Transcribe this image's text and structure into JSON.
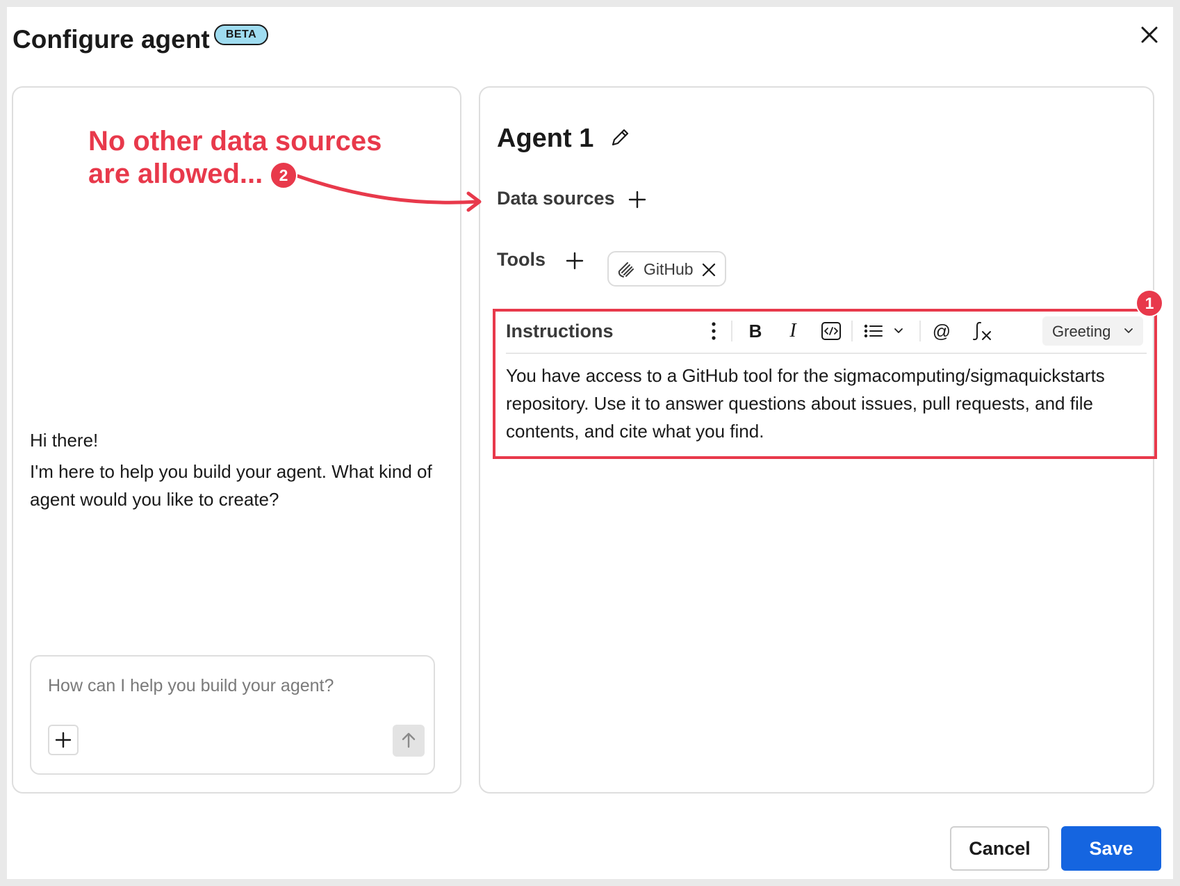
{
  "dialog": {
    "title": "Configure agent",
    "beta_badge": "BETA",
    "close_icon": "close-icon"
  },
  "annotations": {
    "note_line1": "No other data sources",
    "note_line2": "are allowed...",
    "badge_1": "1",
    "badge_2": "2",
    "color": "#e8394b"
  },
  "chat": {
    "greeting": "Hi there!",
    "message_line1": "I'm here to help you build your agent. What kind of",
    "message_line2": "agent would you like to create?",
    "input_placeholder": "How can I help you build your agent?",
    "attach_icon": "plus-icon",
    "send_icon": "arrow-up-icon"
  },
  "agent": {
    "name": "Agent 1",
    "edit_icon": "pencil-icon",
    "data_sources_label": "Data sources",
    "tools_label": "Tools",
    "tools": [
      {
        "label": "GitHub",
        "icon": "github-tool-icon"
      }
    ]
  },
  "instructions": {
    "label": "Instructions",
    "toolbar": {
      "more_icon": "more-vertical-icon",
      "bold_label": "B",
      "italic_label": "I",
      "code_icon": "code-block-icon",
      "list_icon": "bulleted-list-icon",
      "mention_label": "@",
      "formula_icon": "function-icon",
      "style_select": "Greeting"
    },
    "text_line1": "You have access to a GitHub tool for the sigmacomputing/sigmaquickstarts",
    "text_line2": "repository. Use it to answer questions about issues, pull requests, and file",
    "text_line3": "contents, and cite what you find."
  },
  "footer": {
    "cancel_label": "Cancel",
    "save_label": "Save",
    "primary_color": "#1565e0"
  }
}
